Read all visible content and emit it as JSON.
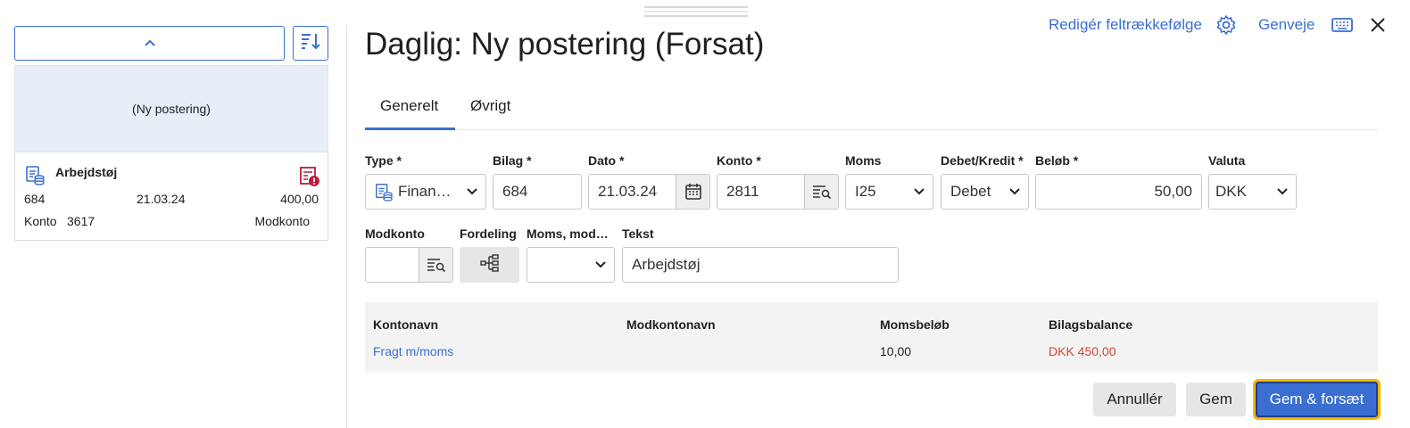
{
  "sidebar": {
    "new_entry_label": "(Ny postering)",
    "entry": {
      "title": "Arbejdstøj",
      "bilag": "684",
      "date": "21.03.24",
      "amount": "400,00",
      "konto_label": "Konto",
      "konto_value": "3617",
      "modkonto_label": "Modkonto"
    }
  },
  "header": {
    "title": "Daglig: Ny postering (Forsat)",
    "edit_field_order_label": "Redigér feltrækkefølge",
    "shortcuts_label": "Genveje"
  },
  "tabs": [
    {
      "label": "Generelt",
      "active": true
    },
    {
      "label": "Øvrigt",
      "active": false
    }
  ],
  "form": {
    "type": {
      "label": "Type *",
      "value": "Finan…"
    },
    "bilag": {
      "label": "Bilag *",
      "value": "684"
    },
    "dato": {
      "label": "Dato *",
      "value": "21.03.24"
    },
    "konto": {
      "label": "Konto *",
      "value": "2811"
    },
    "moms": {
      "label": "Moms",
      "value": "I25"
    },
    "debet_kredit": {
      "label": "Debet/Kredit *",
      "value": "Debet"
    },
    "belob": {
      "label": "Beløb *",
      "value": "50,00"
    },
    "valuta": {
      "label": "Valuta",
      "value": "DKK"
    },
    "modkonto": {
      "label": "Modkonto",
      "value": ""
    },
    "fordeling": {
      "label": "Fordeling"
    },
    "moms_mod": {
      "label": "Moms, mod…",
      "value": ""
    },
    "tekst": {
      "label": "Tekst",
      "value": "Arbejdstøj"
    }
  },
  "info_table": {
    "headers": [
      "Kontonavn",
      "Modkontonavn",
      "Momsbeløb",
      "Bilagsbalance"
    ],
    "row": {
      "kontonavn": "Fragt m/moms",
      "modkontonavn": "",
      "momsbelob": "10,00",
      "bilagsbalance": "DKK 450,00"
    }
  },
  "footer": {
    "cancel_label": "Annullér",
    "save_label": "Gem",
    "save_continue_label": "Gem & forsæt"
  },
  "colors": {
    "accent": "#3a6fd1",
    "link": "#3a6fd1",
    "negative": "#d0453a",
    "focus_outline": "#f2b705"
  },
  "icons": [
    "chevron-up-icon",
    "sort-icon",
    "finance-type-icon",
    "warning-document-icon",
    "settings-gear-icon",
    "keyboard-icon",
    "close-icon",
    "calendar-icon",
    "lookup-list-icon",
    "distribution-tree-icon",
    "chevron-down-icon"
  ]
}
